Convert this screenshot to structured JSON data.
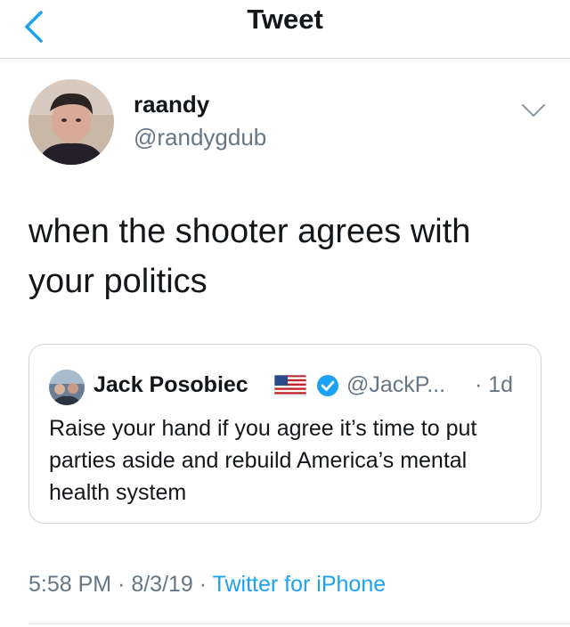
{
  "nav": {
    "title": "Tweet",
    "back_icon": "chevron-left-icon"
  },
  "tweet": {
    "display_name": "raandy",
    "handle": "@randygdub",
    "text": "when the shooter agrees with your politics",
    "more_icon": "chevron-down-icon"
  },
  "quoted_tweet": {
    "display_name": "Jack Posobiec",
    "flag_icon": "us-flag-icon",
    "verified_icon": "verified-badge-icon",
    "handle": "@JackP...",
    "time": "· 1d",
    "text": "Raise your hand if you agree it’s time to put parties aside and rebuild America’s mental health system"
  },
  "meta": {
    "time": "5:58 PM",
    "sep1": " · ",
    "date": "8/3/19",
    "sep2": " · ",
    "source": "Twitter for iPhone"
  },
  "colors": {
    "accent": "#1da1f2",
    "secondary_text": "#657786",
    "border": "#ccd6dd"
  }
}
